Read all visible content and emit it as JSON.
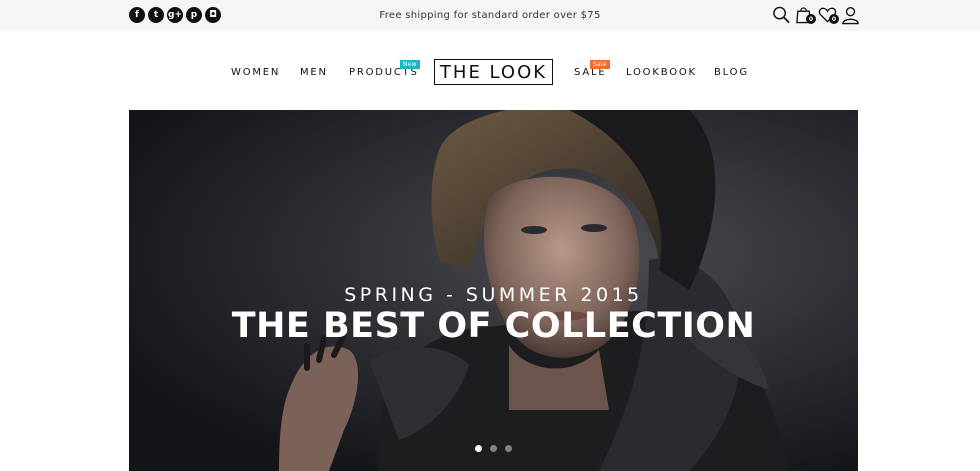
{
  "topbar": {
    "socials": [
      {
        "icon": "facebook-icon",
        "glyph": "f"
      },
      {
        "icon": "twitter-icon",
        "glyph": "t"
      },
      {
        "icon": "google-plus-icon",
        "glyph": "g+"
      },
      {
        "icon": "pinterest-icon",
        "glyph": "p"
      },
      {
        "icon": "instagram-icon",
        "glyph": "◘"
      }
    ],
    "shipping_text": "Free shipping for standard order over $75",
    "cart_count": "0",
    "wishlist_count": "0"
  },
  "nav": {
    "women": "WOMEN",
    "men": "MEN",
    "products": "PRODUCTS",
    "products_tag": "New",
    "logo": "THE LOOK",
    "sale": "SALE",
    "sale_tag": "Sale",
    "lookbook": "LOOKBOOK",
    "blog": "BLOG"
  },
  "hero": {
    "subtitle": "SPRING - SUMMER 2015",
    "title": "THE BEST OF COLLECTION",
    "active_slide": 1,
    "slide_count": 3
  },
  "colors": {
    "new_tag": "#1fb5c4",
    "sale_tag": "#f26b3a",
    "topbar_bg": "#f5f5f5"
  }
}
